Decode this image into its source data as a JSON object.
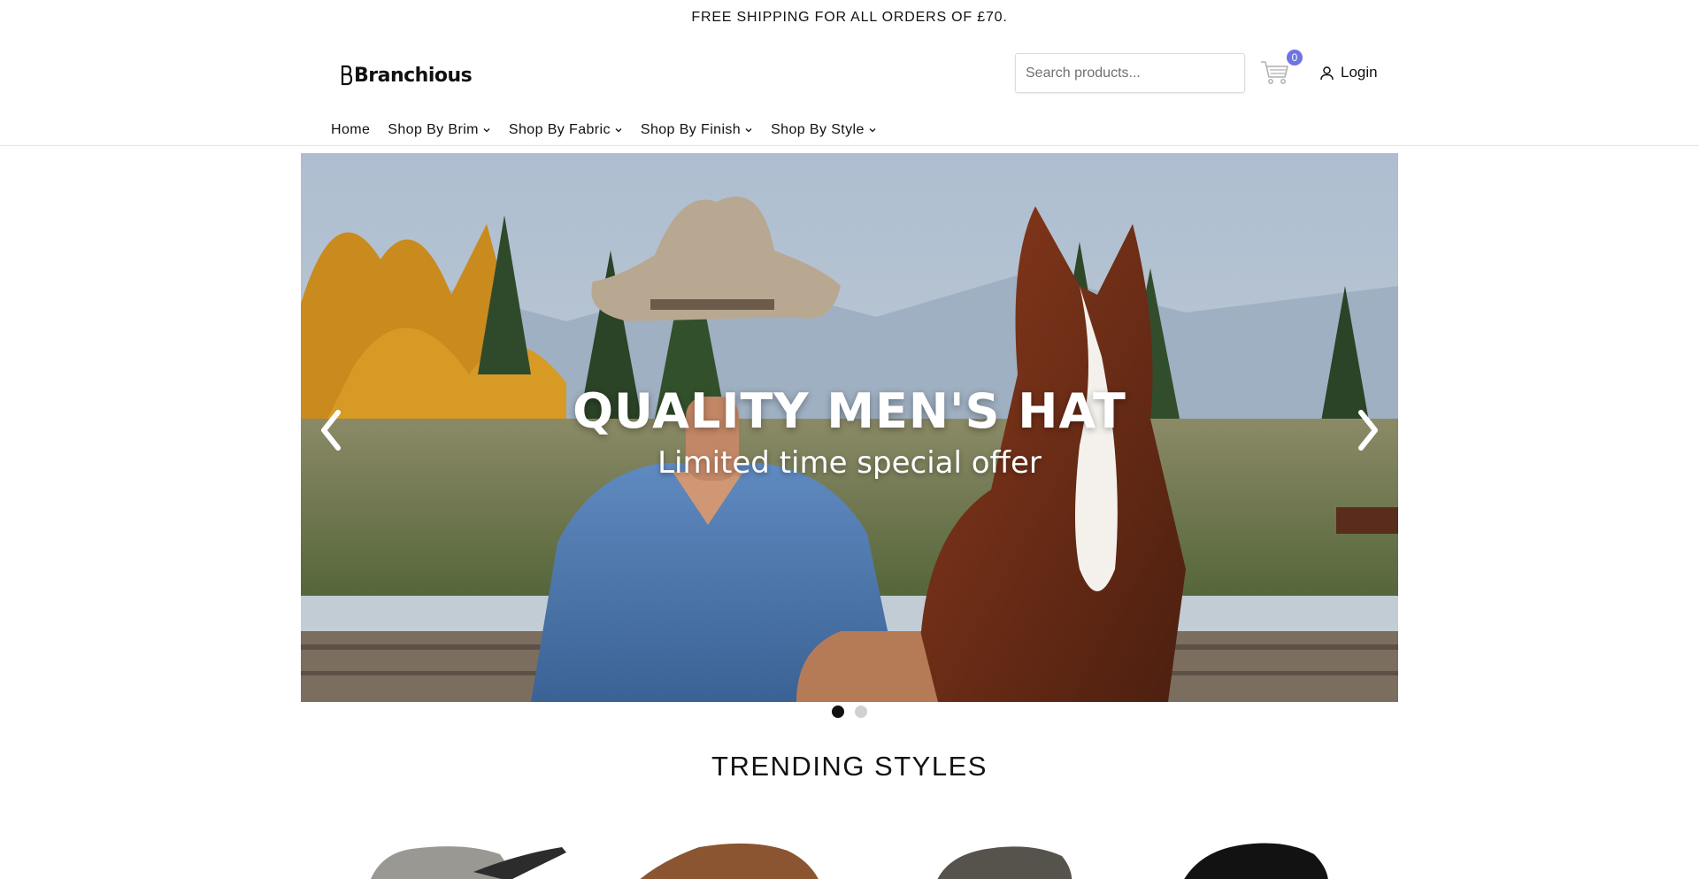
{
  "announcement": {
    "text": "FREE SHIPPING FOR ALL ORDERS OF £70."
  },
  "header": {
    "logo_text": "Branchious",
    "search_placeholder": "Search products...",
    "cart_count": "0",
    "login_label": "Login",
    "cart_icon": "shopping-cart-icon",
    "user_icon": "user-icon"
  },
  "nav": {
    "items": [
      {
        "label": "Home",
        "has_dropdown": false
      },
      {
        "label": "Shop By Brim",
        "has_dropdown": true
      },
      {
        "label": "Shop By Fabric",
        "has_dropdown": true
      },
      {
        "label": "Shop By Finish",
        "has_dropdown": true
      },
      {
        "label": "Shop By Style",
        "has_dropdown": true
      }
    ]
  },
  "hero": {
    "title": "QUALITY MEN'S HAT",
    "subtitle": "Limited time special offer",
    "slides": 2,
    "active_slide": 1
  },
  "trending": {
    "title": "TRENDING STYLES",
    "products": [
      {
        "hat_color": "#9a9893"
      },
      {
        "hat_color": "#8a5530"
      },
      {
        "hat_color": "#56534d"
      },
      {
        "hat_color": "#121212"
      }
    ]
  },
  "colors": {
    "badge": "#6f75e0",
    "text": "#121212",
    "border": "#e6e6e6"
  }
}
